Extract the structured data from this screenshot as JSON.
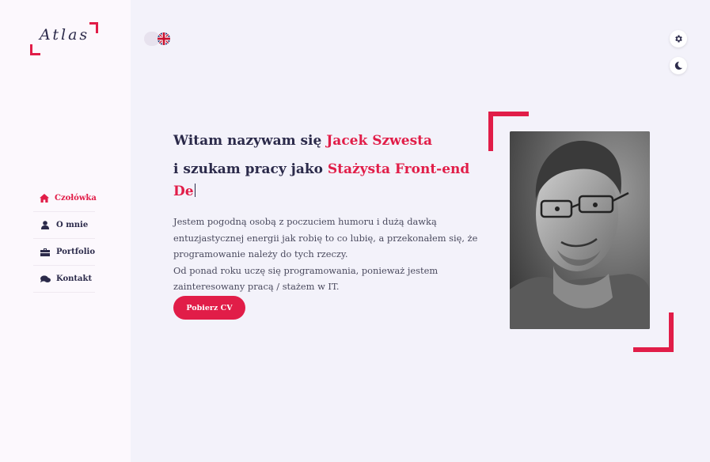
{
  "sidebar": {
    "logo_text": "Atlas",
    "items": [
      {
        "label": "Czołówka",
        "icon": "home-icon",
        "active": true
      },
      {
        "label": "O mnie",
        "icon": "user-icon",
        "active": false
      },
      {
        "label": "Portfolio",
        "icon": "briefcase-icon",
        "active": false
      },
      {
        "label": "Kontakt",
        "icon": "comments-icon",
        "active": false
      }
    ]
  },
  "header": {
    "language_flag": "uk-flag-icon",
    "settings_icon": "gear-icon",
    "theme_icon": "moon-icon"
  },
  "hero": {
    "greeting_prefix": "Witam nazywam się ",
    "name": "Jacek Szwesta",
    "seeking_prefix": "i szukam pracy jako ",
    "role_typed": "Stażysta Front-end De",
    "description_1": "Jestem pogodną osobą z poczuciem humoru i dużą dawką entuzjastycznej energii jak robię to co lubię, a przekonałem się, że programowanie należy do tych rzeczy.",
    "description_2": "Od ponad roku uczę się programowania, ponieważ jestem zainteresowany pracą / stażem w IT.",
    "cv_button": "Pobierz CV"
  },
  "colors": {
    "accent": "#e11d48",
    "text": "#2b2a4a",
    "background": "#f3f2fa",
    "sidebar": "#fcf8fd"
  }
}
